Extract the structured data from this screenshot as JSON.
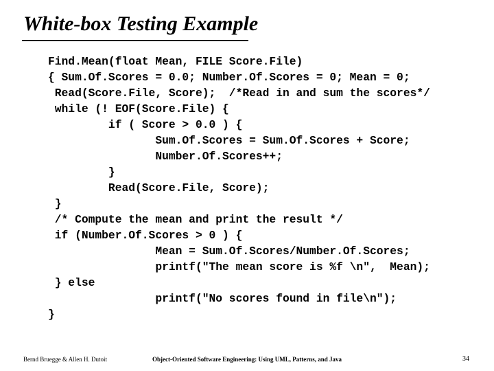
{
  "title": "White-box Testing Example",
  "code": "Find.Mean(float Mean, FILE Score.File)\n{ Sum.Of.Scores = 0.0; Number.Of.Scores = 0; Mean = 0;\n Read(Score.File, Score);  /*Read in and sum the scores*/\n while (! EOF(Score.File) {\n         if ( Score > 0.0 ) {\n                Sum.Of.Scores = Sum.Of.Scores + Score;\n                Number.Of.Scores++;\n         }\n         Read(Score.File, Score);\n }\n /* Compute the mean and print the result */\n if (Number.Of.Scores > 0 ) {\n                Mean = Sum.Of.Scores/Number.Of.Scores;\n                printf(\"The mean score is %f \\n\",  Mean);\n } else\n                printf(\"No scores found in file\\n\");\n}",
  "footer": {
    "left": "Bernd Bruegge & Allen H. Dutoit",
    "center": "Object-Oriented Software Engineering: Using UML, Patterns, and Java",
    "right": "34"
  }
}
